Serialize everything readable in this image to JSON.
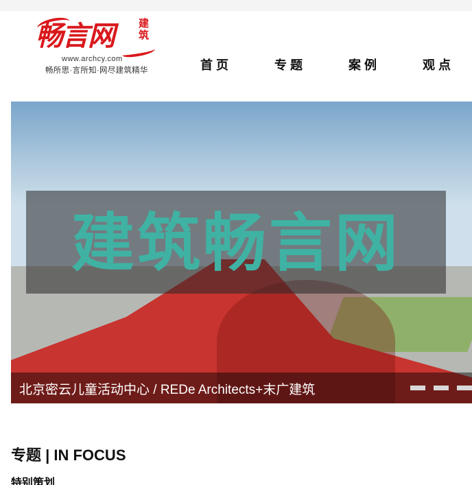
{
  "logo": {
    "main": "畅言网",
    "side": "建筑",
    "url": "www.archcy.com",
    "tagline": "畅所思·言所知·网尽建筑精华",
    "color": "#d9181c"
  },
  "nav": {
    "items": [
      {
        "label": "首页"
      },
      {
        "label": "专题"
      },
      {
        "label": "案例"
      },
      {
        "label": "观点"
      }
    ]
  },
  "hero": {
    "caption": "北京密云儿童活动中心 / REDe Architects+末广建筑",
    "watermark": "建筑畅言网",
    "slide_count": 3
  },
  "section": {
    "title": "专题 | IN FOCUS",
    "subtitle": "特别策划"
  },
  "colors": {
    "accent": "#d9181c",
    "watermark": "#3fb2a4"
  }
}
